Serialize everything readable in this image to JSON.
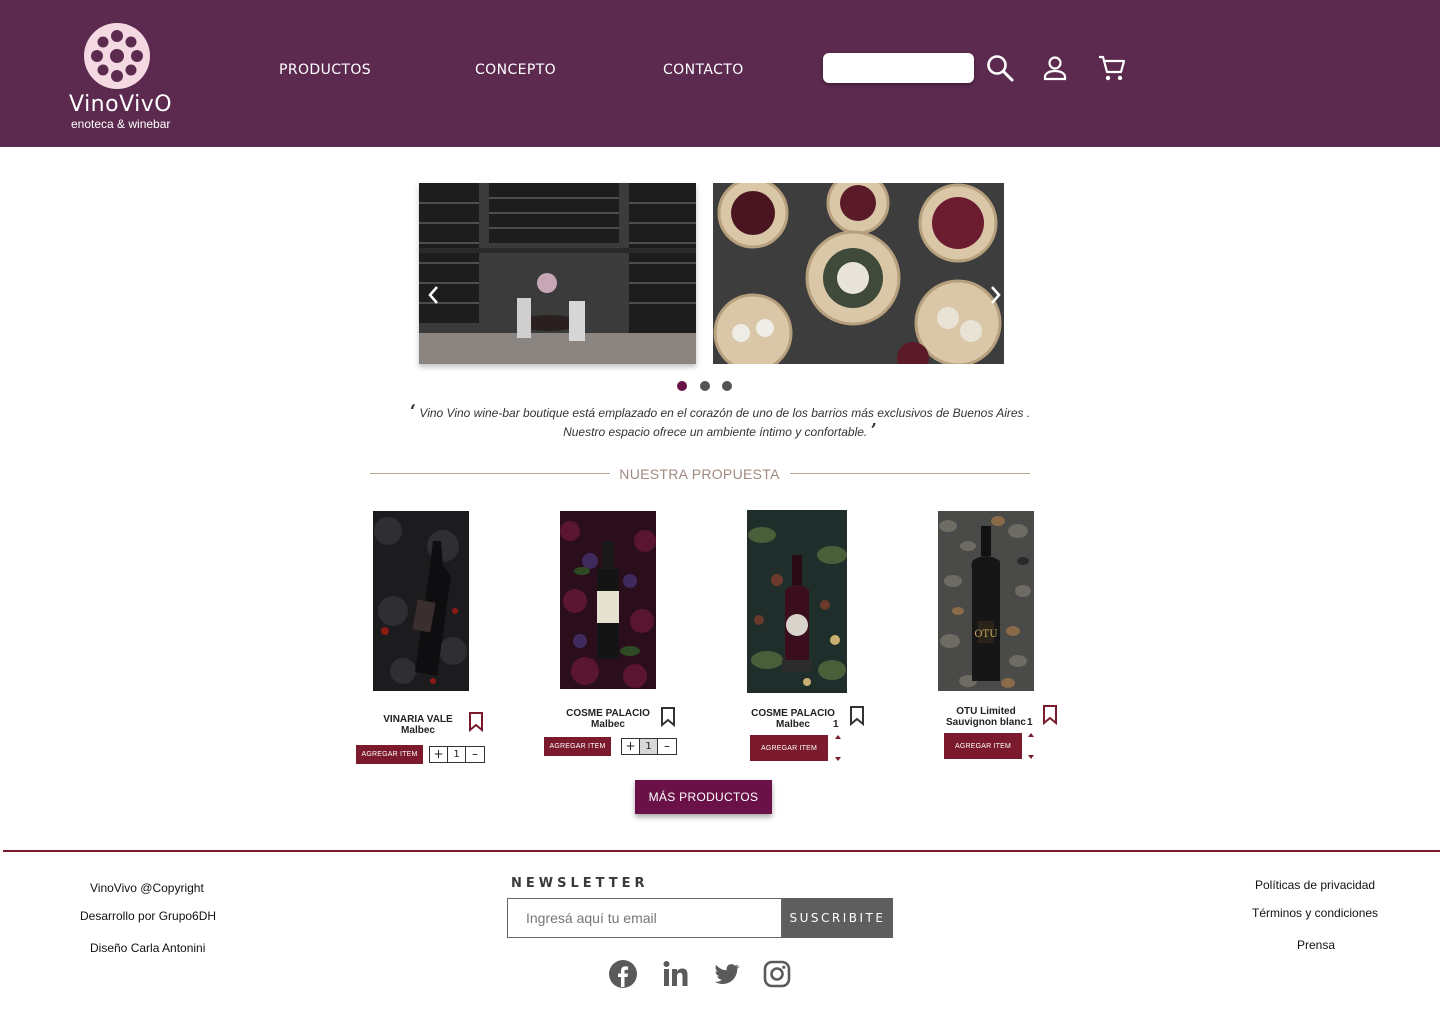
{
  "brand": {
    "name": "VinoVivO",
    "tagline": "enoteca & winebar",
    "primary_color": "#5c2a4e",
    "accent_color": "#6a1248",
    "button_color": "#7a1a2c"
  },
  "nav": {
    "items": [
      {
        "label": "PRODUCTOS"
      },
      {
        "label": "CONCEPTO"
      },
      {
        "label": "CONTACTO"
      }
    ],
    "search_placeholder": "",
    "icons": [
      "search-icon",
      "user-icon",
      "cart-icon"
    ]
  },
  "carousel": {
    "slides": [
      "wine-cellar-bar-photo",
      "dim-sum-and-wine-photo"
    ],
    "active_index": 0,
    "dot_count": 3
  },
  "quote": {
    "line1": "Vino Vino wine-bar boutique está emplazado en el corazón de uno de los barrios más exclusivos de Buenos Aires .",
    "line2": "Nuestro espacio ofrece un ambiente íntimo y confortable."
  },
  "section_title": "NUESTRA PROPUESTA",
  "products": [
    {
      "name_line1": "VINARIA VALE",
      "name_line2": "Malbec",
      "button": "AGREGAR ITEM",
      "qty": "1",
      "minus": "–",
      "plus": "+"
    },
    {
      "name_line1": "COSME  PALACIO",
      "name_line2": "Malbec",
      "button": "AGREGAR ITEM",
      "qty": "1",
      "minus": "–",
      "plus": "+"
    },
    {
      "name_line1": "COSME  PALACIO",
      "name_line2": "Malbec",
      "button": "AGREGAR ITEM",
      "qty": "1"
    },
    {
      "name_line1": "OTU Limited",
      "name_line2": "Sauvignon blanc",
      "button": "AGREGAR ITEM",
      "qty": "1"
    }
  ],
  "more_button": "MÁS PRODUCTOS",
  "footer": {
    "left": [
      "VinoVivo @Copyright",
      "Desarrollo por Grupo6DH",
      "Diseño Carla Antonini"
    ],
    "newsletter_title": "NEWSLETTER",
    "newsletter_placeholder": "Ingresá aquí tu email",
    "newsletter_button": "SUSCRIBITE",
    "right": [
      "Políticas de privacidad",
      "Términos y condiciones",
      "Prensa"
    ],
    "social": [
      "facebook-icon",
      "linkedin-icon",
      "twitter-icon",
      "instagram-icon"
    ]
  }
}
